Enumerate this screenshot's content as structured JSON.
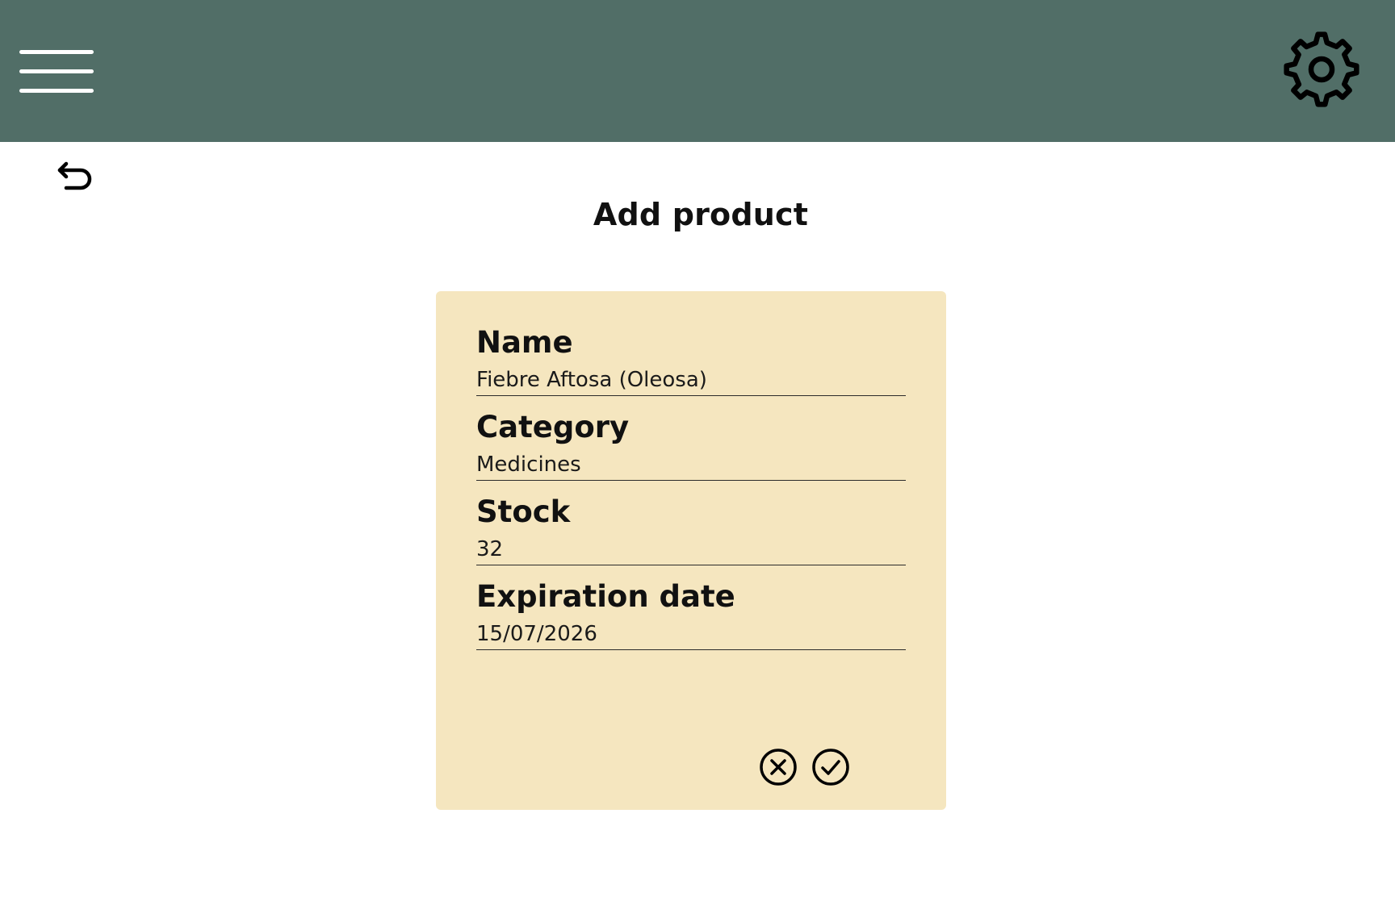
{
  "header": {
    "background_color": "#516e67",
    "menu_icon": "hamburger-menu-icon",
    "settings_icon": "gear-icon"
  },
  "nav": {
    "back_icon": "undo-arrow-icon"
  },
  "page": {
    "title": "Add product"
  },
  "form": {
    "card_color": "#f5e6bf",
    "fields": [
      {
        "label": "Name",
        "value": "Fiebre Aftosa (Oleosa)"
      },
      {
        "label": "Category",
        "value": "Medicines"
      },
      {
        "label": "Stock",
        "value": "32"
      },
      {
        "label": "Expiration date",
        "value": "15/07/2026"
      }
    ],
    "cancel_icon": "circle-x-icon",
    "confirm_icon": "circle-check-icon"
  }
}
